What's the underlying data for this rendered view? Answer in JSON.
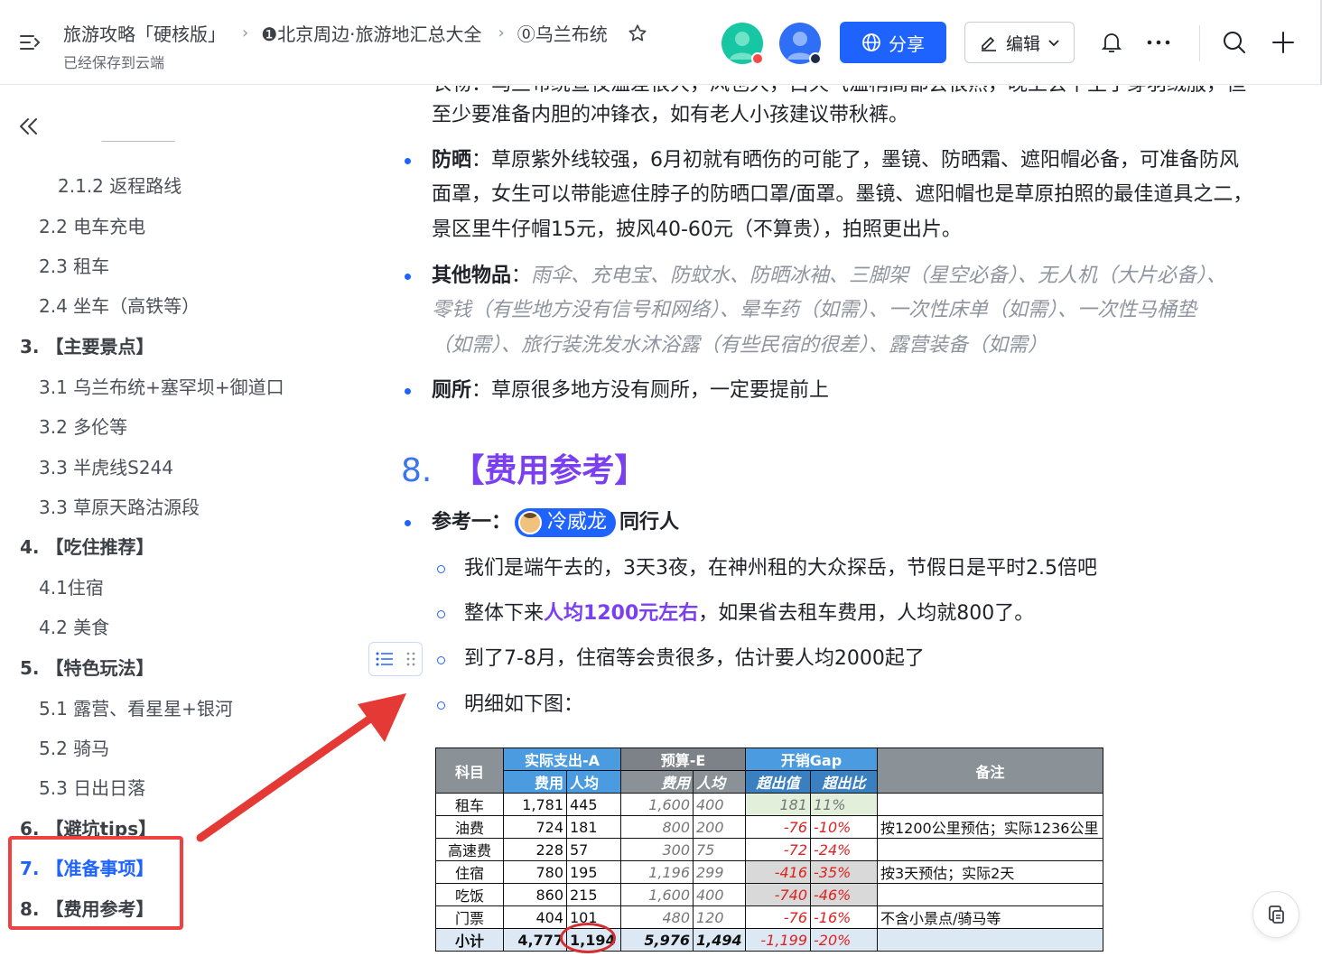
{
  "header": {
    "breadcrumbs": [
      "旅游攻略「硬核版」",
      "❶北京周边·旅游地汇总大全",
      "⓪乌兰布统"
    ],
    "saved_status": "已经保存到云端",
    "share_label": "分享",
    "edit_label": "编辑"
  },
  "sidebar": {
    "items": [
      {
        "label": "2.1.2 返程路线",
        "level": 3
      },
      {
        "label": "2.2 电车充电",
        "level": 2
      },
      {
        "label": "2.3 租车",
        "level": 2
      },
      {
        "label": "2.4 坐车（高铁等）",
        "level": 2
      },
      {
        "label": "3. 【主要景点】",
        "level": 1
      },
      {
        "label": "3.1 乌兰布统+塞罕坝+御道口",
        "level": 2
      },
      {
        "label": "3.2 多伦等",
        "level": 2
      },
      {
        "label": "3.3 半虎线S244",
        "level": 2
      },
      {
        "label": "3.3 草原天路沽源段",
        "level": 2
      },
      {
        "label": "4. 【吃住推荐】",
        "level": 1
      },
      {
        "label": "4.1住宿",
        "level": 2
      },
      {
        "label": "4.2 美食",
        "level": 2
      },
      {
        "label": "5. 【特色玩法】",
        "level": 1
      },
      {
        "label": "5.1 露营、看星星+银河",
        "level": 2
      },
      {
        "label": "5.2 骑马",
        "level": 2
      },
      {
        "label": "5.3 日出日落",
        "level": 2
      },
      {
        "label": "6. 【避坑tips】",
        "level": 1
      },
      {
        "label": "7. 【准备事项】",
        "level": 1,
        "active": true
      },
      {
        "label": "8. 【费用参考】",
        "level": 1
      }
    ]
  },
  "doc": {
    "cut_line": "衣物：乌兰布统昼夜温差很大，风也大，白天气温稍高都会很热，晚上会下主于穿羽绒服，但",
    "clothing_line2": "至少要准备内胆的冲锋衣，如有老人小孩建议带秋裤。",
    "sunscreen_label": "防晒",
    "sunscreen_l1": "：草原紫外线较强，6月初就有晒伤的可能了，墨镜、防晒霜、遮阳帽必备，可准备防风",
    "sunscreen_l2": "面罩，女生可以带能遮住脖子的防晒口罩/面罩。墨镜、遮阳帽也是草原拍照的最佳道具之二，",
    "sunscreen_l3": "景区里牛仔帽15元，披风40-60元（不算贵），拍照更出片。",
    "other_label": "其他物品",
    "other_colon": "：",
    "other_l1": "雨伞、充电宝、防蚊水、防晒冰袖、三脚架（星空必备）、无人机（大片必备）、",
    "other_l2": "零钱（有些地方没有信号和网络）、晕车药（如需）、一次性床单（如需）、一次性马桶垫",
    "other_l3": "（如需）、旅行装洗发水沐浴露（有些民宿的很差）、露营装备（如需）",
    "toilet_label": "厕所",
    "toilet_text": "：草原很多地方没有厕所，一定要提前上",
    "h8_num": "8.",
    "h8_title": "【费用参考】",
    "ref1_label": "参考一：",
    "mention_name": "冷威龙",
    "companion": "同行人",
    "sub1": "我们是端午去的，3天3夜，在神州租的大众探岳，节假日是平时2.5倍吧",
    "sub2_pre": "整体下来",
    "sub2_hl": "人均1200元左右",
    "sub2_post": "，如果省去租车费用，人均就800了。",
    "sub3": "到了7-8月，住宿等会贵很多，估计要人均2000起了",
    "sub4": "明细如下图："
  },
  "table": {
    "headers": {
      "subject": "科目",
      "actual": "实际支出-A",
      "budget": "预算-E",
      "gap": "开销Gap",
      "note": "备注",
      "fee": "费用",
      "per": "人均",
      "over_val": "超出值",
      "over_pct": "超出比"
    },
    "rows": [
      {
        "item": "租车",
        "fee": "1,781",
        "per": "445",
        "bfee": "1,600",
        "bper": "400",
        "gv": "181",
        "gp": "11%",
        "note": ""
      },
      {
        "item": "油费",
        "fee": "724",
        "per": "181",
        "bfee": "800",
        "bper": "200",
        "gv": "-76",
        "gp": "-10%",
        "note": "按1200公里预估；实际1236公里"
      },
      {
        "item": "高速费",
        "fee": "228",
        "per": "57",
        "bfee": "300",
        "bper": "75",
        "gv": "-72",
        "gp": "-24%",
        "note": ""
      },
      {
        "item": "住宿",
        "fee": "780",
        "per": "195",
        "bfee": "1,196",
        "bper": "299",
        "gv": "-416",
        "gp": "-35%",
        "note": "按3天预估；实际2天"
      },
      {
        "item": "吃饭",
        "fee": "860",
        "per": "215",
        "bfee": "1,600",
        "bper": "400",
        "gv": "-740",
        "gp": "-46%",
        "note": ""
      },
      {
        "item": "门票",
        "fee": "404",
        "per": "101",
        "bfee": "480",
        "bper": "120",
        "gv": "-76",
        "gp": "-16%",
        "note": "不含小景点/骑马等"
      }
    ],
    "total": {
      "item": "小计",
      "fee": "4,777",
      "per": "1,194",
      "bfee": "5,976",
      "bper": "1,494",
      "gv": "-1,199",
      "gp": "-20%",
      "note": ""
    }
  }
}
